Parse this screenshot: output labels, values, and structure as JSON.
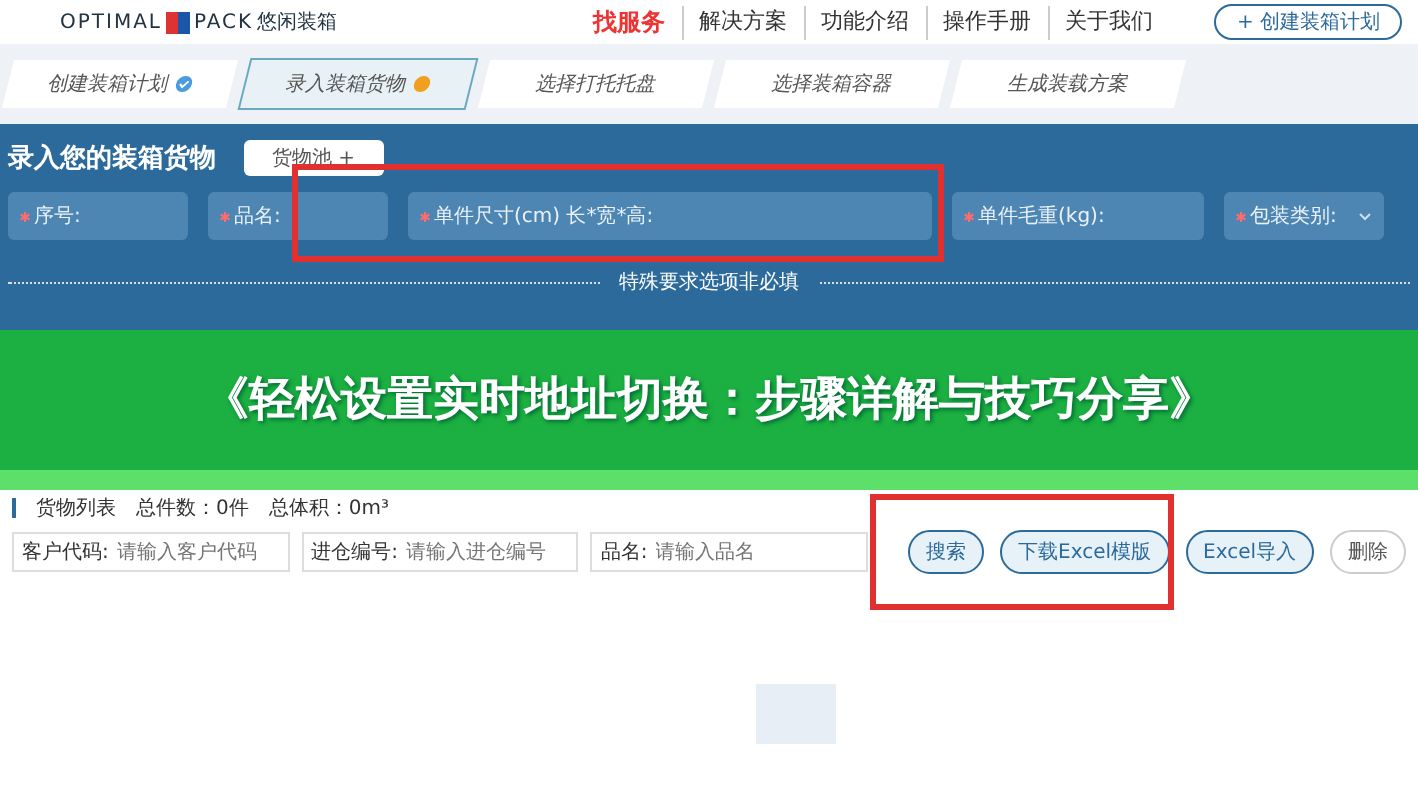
{
  "header": {
    "logo_left": "OPTIMAL",
    "logo_right": "PACK",
    "brand": "悠闲装箱",
    "nav": [
      {
        "label": "找服务",
        "selected": true
      },
      {
        "label": "解决方案",
        "selected": false
      },
      {
        "label": "功能介绍",
        "selected": false
      },
      {
        "label": "操作手册",
        "selected": false
      },
      {
        "label": "关于我们",
        "selected": false
      }
    ],
    "create_button": "+ 创建装箱计划"
  },
  "steps": [
    {
      "label": "创建装箱计划",
      "selected": false,
      "done": true
    },
    {
      "label": "录入装箱货物",
      "selected": true,
      "done": false
    },
    {
      "label": "选择打托托盘",
      "selected": false,
      "done": false
    },
    {
      "label": "选择装箱容器",
      "selected": false,
      "done": false
    },
    {
      "label": "生成装载方案",
      "selected": false,
      "done": false
    }
  ],
  "cargo_form": {
    "title": "录入您的装箱货物",
    "pool_button": "货物池 +",
    "fields": [
      {
        "label": "序号:",
        "kind": "text",
        "required": true
      },
      {
        "label": "品名:",
        "kind": "text",
        "required": true
      },
      {
        "label": "单件尺寸(cm) 长*宽*高:",
        "kind": "text",
        "required": true
      },
      {
        "label": "单件毛重(kg):",
        "kind": "text",
        "required": true
      },
      {
        "label": "包装类别:",
        "kind": "select",
        "required": true
      }
    ],
    "special_note": "特殊要求选项非必填"
  },
  "banner": {
    "title": "《轻松设置实时地址切换：步骤详解与技巧分享》"
  },
  "cargo_list": {
    "title": "货物列表",
    "total_count": "总件数：0件",
    "total_volume": "总体积：0m³",
    "filters": [
      {
        "label": "客户代码:",
        "placeholder": "请输入客户代码"
      },
      {
        "label": "进仓编号:",
        "placeholder": "请输入进仓编号"
      },
      {
        "label": "品名:",
        "placeholder": "请输入品名"
      }
    ],
    "buttons": [
      {
        "label": "搜索",
        "kind": "primary"
      },
      {
        "label": "下载Excel模版",
        "kind": "primary"
      },
      {
        "label": "Excel导入",
        "kind": "primary"
      },
      {
        "label": "删除",
        "kind": "plain"
      }
    ]
  }
}
